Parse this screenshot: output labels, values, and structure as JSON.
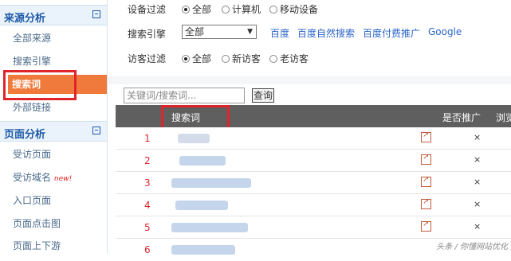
{
  "sidebar": {
    "section1": {
      "title": "来源分析",
      "items": [
        "全部来源",
        "搜索引擎",
        "搜索词",
        "外部链接"
      ]
    },
    "section2": {
      "title": "页面分析",
      "items": [
        "受访页面",
        "受访域名",
        "入口页面",
        "页面点击图",
        "页面上下游"
      ],
      "new_badge": "new!"
    }
  },
  "filters": {
    "device": {
      "label": "设备过滤",
      "options": [
        "全部",
        "计算机",
        "移动设备"
      ],
      "selected": "全部"
    },
    "engine": {
      "label": "搜索引擎",
      "selected": "全部",
      "links": [
        "百度",
        "百度自然搜索",
        "百度付费推广",
        "Google"
      ]
    },
    "visitor": {
      "label": "访客过滤",
      "options": [
        "全部",
        "新访客",
        "老访客"
      ],
      "selected": "全部"
    }
  },
  "search": {
    "placeholder": "关键词/搜索词...",
    "button": "查询"
  },
  "table": {
    "headers": [
      "搜索词",
      "是否推广",
      "浏览"
    ],
    "rows": [
      {
        "rank": "1",
        "promoted": "×"
      },
      {
        "rank": "2",
        "promoted": "×"
      },
      {
        "rank": "3",
        "promoted": "×"
      },
      {
        "rank": "4",
        "promoted": "×"
      },
      {
        "rank": "5",
        "promoted": "×"
      },
      {
        "rank": "6",
        "promoted": ""
      }
    ]
  },
  "watermark": "头条 / 你懂网站优化",
  "colors": {
    "active": "#f07a3b",
    "highlight": "#e0242b",
    "link": "#2a64c8"
  }
}
